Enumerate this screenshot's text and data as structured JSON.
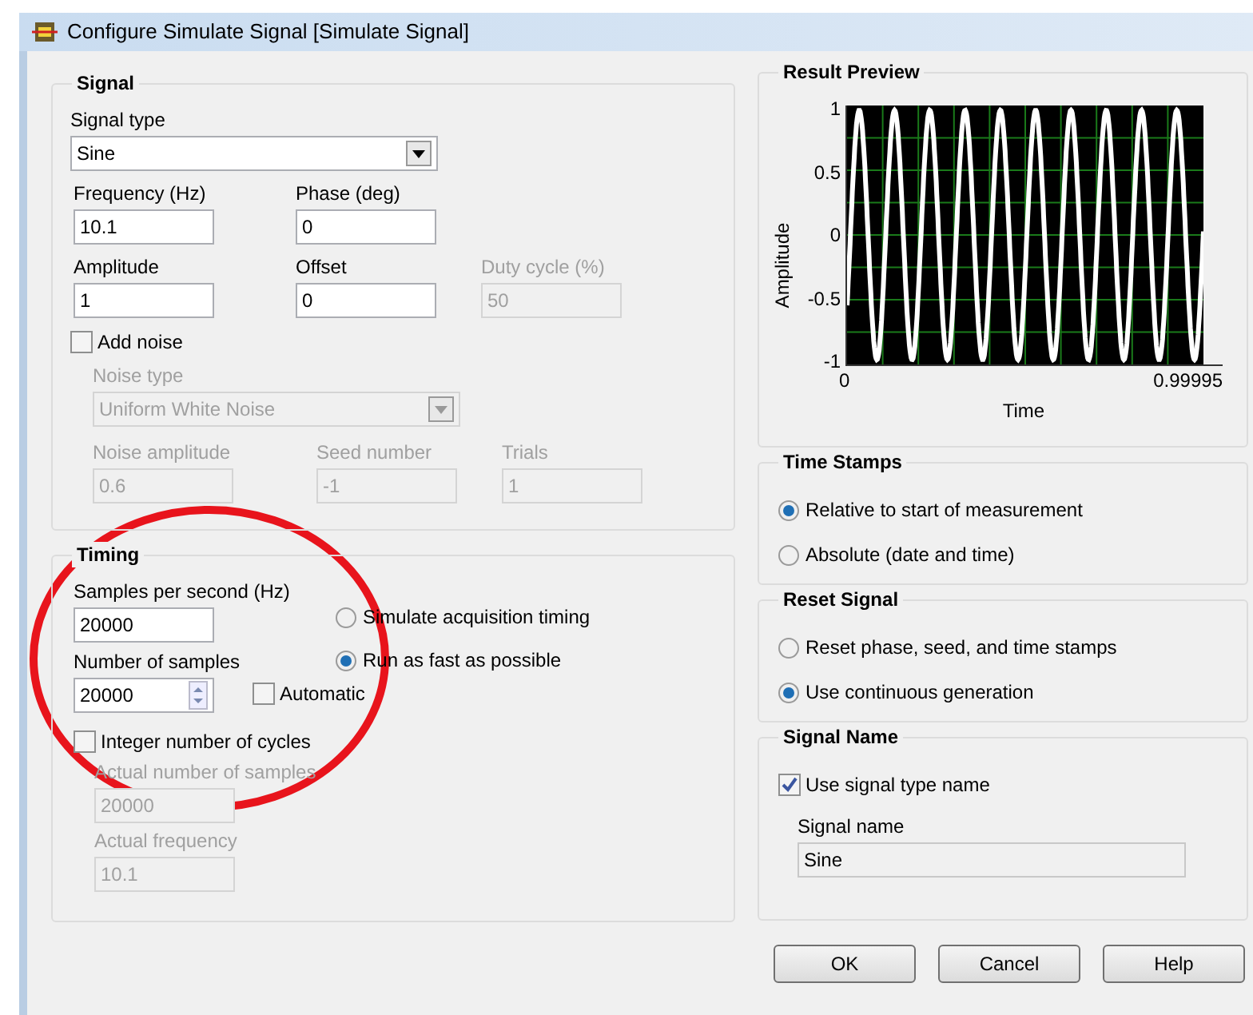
{
  "window": {
    "title": "Configure Simulate Signal [Simulate Signal]"
  },
  "signal": {
    "title": "Signal",
    "signal_type": {
      "label": "Signal type",
      "value": "Sine",
      "disabled": false
    },
    "rows": [
      [
        {
          "label": "Frequency (Hz)",
          "value": "10.1",
          "disabled": false
        },
        {
          "label": "Phase (deg)",
          "value": "0",
          "disabled": false
        }
      ],
      [
        {
          "label": "Amplitude",
          "value": "1",
          "disabled": false
        },
        {
          "label": "Offset",
          "value": "0",
          "disabled": false
        },
        {
          "label": "Duty cycle (%)",
          "value": "50",
          "disabled": true
        }
      ]
    ],
    "add_noise": {
      "label": "Add noise",
      "checked": false
    },
    "noise_type": {
      "label": "Noise type",
      "value": "Uniform White Noise",
      "disabled": true
    },
    "noise_fields": [
      {
        "label": "Noise amplitude",
        "value": "0.6",
        "disabled": true
      },
      {
        "label": "Seed number",
        "value": "-1",
        "disabled": true
      },
      {
        "label": "Trials",
        "value": "1",
        "disabled": true
      }
    ]
  },
  "timing": {
    "title": "Timing",
    "samples_per_second": {
      "label": "Samples per second (Hz)",
      "value": "20000",
      "disabled": false
    },
    "number_of_samples": {
      "label": "Number of samples",
      "value": "20000",
      "disabled": false
    },
    "automatic": {
      "label": "Automatic",
      "checked": false
    },
    "modes": [
      {
        "label": "Simulate acquisition timing",
        "selected": false
      },
      {
        "label": "Run as fast as possible",
        "selected": true
      }
    ],
    "integer_cycles": {
      "label": "Integer number of cycles",
      "checked": false
    },
    "actual_fields": [
      {
        "label": "Actual number of samples",
        "value": "20000",
        "disabled": true
      },
      {
        "label": "Actual frequency",
        "value": "10.1",
        "disabled": true
      }
    ]
  },
  "preview": {
    "title": "Result Preview",
    "ylabel": "Amplitude",
    "xlabel": "Time",
    "yticks": [
      "1",
      "0.5",
      "0",
      "-0.5",
      "-1"
    ],
    "xticks": [
      "0",
      "0.99995"
    ]
  },
  "time_stamps": {
    "title": "Time Stamps",
    "options": [
      {
        "label": "Relative to start of measurement",
        "selected": true
      },
      {
        "label": "Absolute (date and time)",
        "selected": false
      }
    ]
  },
  "reset_signal": {
    "title": "Reset Signal",
    "options": [
      {
        "label": "Reset phase, seed, and time stamps",
        "selected": false
      },
      {
        "label": "Use continuous generation",
        "selected": true
      }
    ]
  },
  "signal_name": {
    "title": "Signal Name",
    "use_type_name": {
      "label": "Use signal type name",
      "checked": true
    },
    "name_field": {
      "label": "Signal name",
      "value": "Sine",
      "read_only": true
    }
  },
  "buttons": [
    "OK",
    "Cancel",
    "Help"
  ]
}
